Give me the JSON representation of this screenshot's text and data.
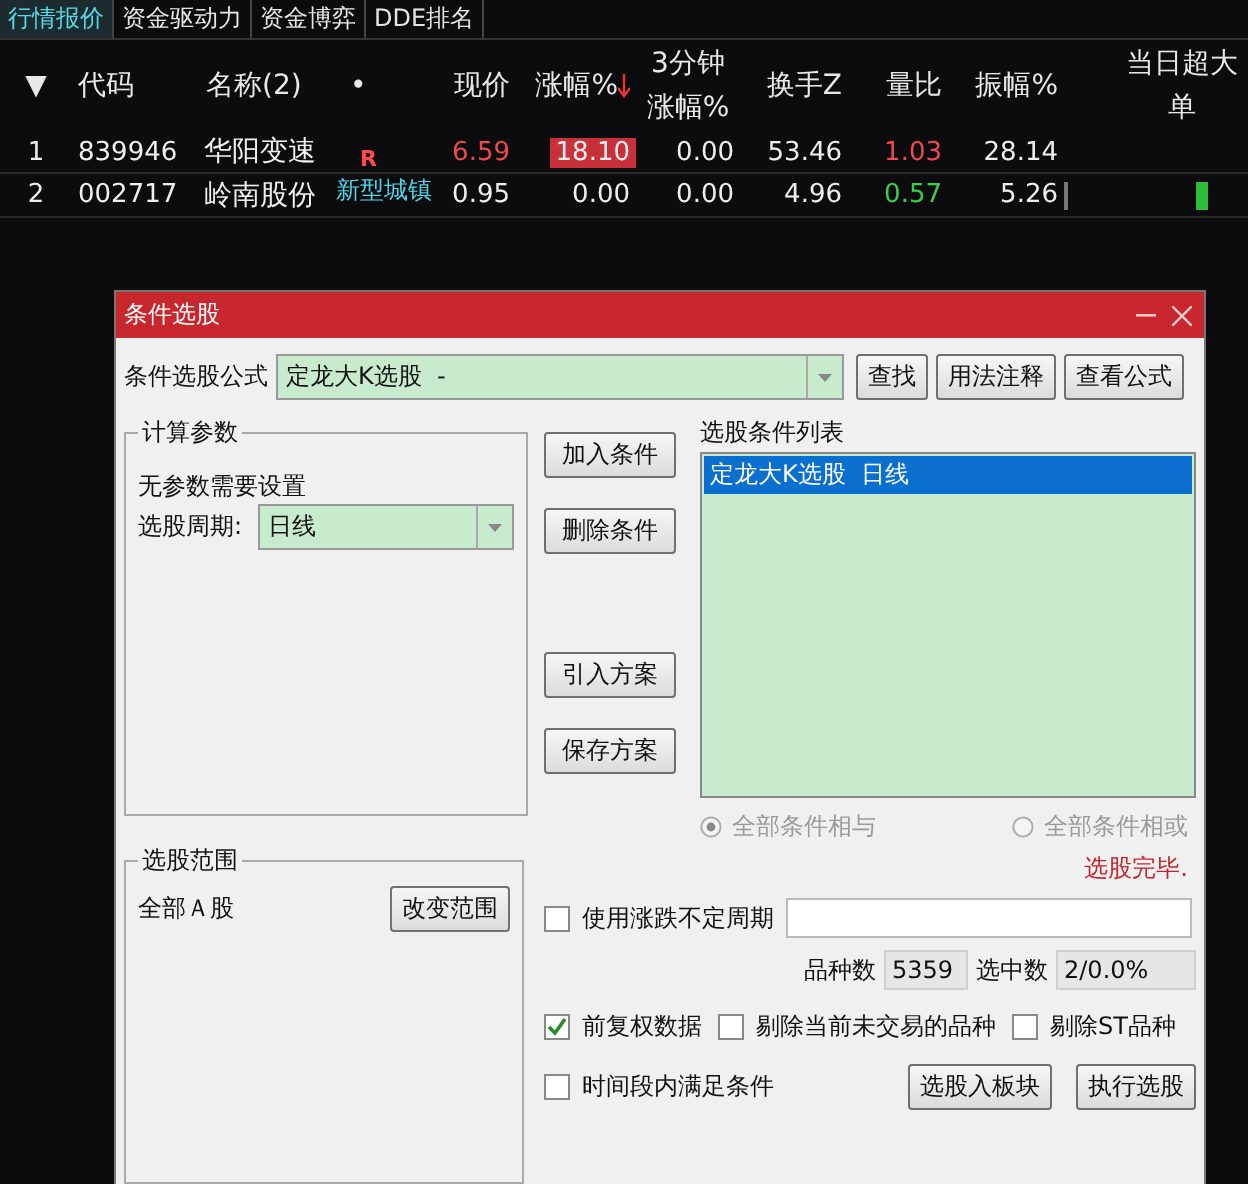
{
  "tabs": [
    {
      "label": "行情报价",
      "selected": true
    },
    {
      "label": "资金驱动力",
      "selected": false
    },
    {
      "label": "资金博弈",
      "selected": false
    },
    {
      "label": "DDE排名",
      "selected": false
    }
  ],
  "table": {
    "columns": [
      {
        "label": "▼"
      },
      {
        "label": "代码"
      },
      {
        "label": "名称(2)"
      },
      {
        "label": "•"
      },
      {
        "label": "现价"
      },
      {
        "label": "涨幅%",
        "sorted_descending": true
      },
      {
        "label": "3分钟涨幅%"
      },
      {
        "label": "换手Z"
      },
      {
        "label": "量比"
      },
      {
        "label": "振幅%"
      },
      {
        "label": "当日超大单"
      }
    ],
    "rows": [
      {
        "index": "1",
        "code": "839946",
        "name": "华阳变速",
        "tag": {
          "kind": "flag",
          "text": "R"
        },
        "price": {
          "text": "6.59",
          "color": "#f0484f"
        },
        "change": {
          "text": "18.10",
          "highlighted": true
        },
        "change3": "0.00",
        "turnover": "53.46",
        "ratio": {
          "text": "1.03",
          "color": "#f0484f"
        },
        "amplitude": "28.14",
        "bar": false
      },
      {
        "index": "2",
        "code": "002717",
        "name": "岭南股份",
        "tag": {
          "kind": "concept",
          "text": "新型城镇"
        },
        "price": {
          "text": "0.95",
          "color": "#eeeeee"
        },
        "change": {
          "text": "0.00",
          "highlighted": false
        },
        "change3": "0.00",
        "turnover": "4.96",
        "ratio": {
          "text": "0.57",
          "color": "#3ccc4a"
        },
        "amplitude": "5.26",
        "bar": true
      }
    ]
  },
  "dialog": {
    "title": "条件选股",
    "formula_label": "条件选股公式",
    "formula_value": "定龙大K选股  -",
    "formula_buttons": [
      "查找",
      "用法注释",
      "查看公式"
    ],
    "params": {
      "title": "计算参数",
      "text": "无参数需要设置",
      "period_label": "选股周期:",
      "period_value": "日线"
    },
    "middle_buttons": [
      "加入条件",
      "删除条件",
      "引入方案",
      "保存方案"
    ],
    "condition_list": {
      "label": "选股条件列表",
      "items": [
        {
          "text": "定龙大K选股  日线",
          "selected": true
        }
      ]
    },
    "logic": [
      {
        "label": "全部条件相与",
        "selected": true
      },
      {
        "label": "全部条件相或",
        "selected": false
      }
    ],
    "range": {
      "title": "选股范围",
      "text": "全部Ａ股",
      "button": "改变范围"
    },
    "status": "选股完毕.",
    "variable_period": {
      "label": "使用涨跌不定周期",
      "checked": false
    },
    "counts": [
      {
        "label": "品种数",
        "value": "5359"
      },
      {
        "label": "选中数",
        "value": "2/0.0%"
      }
    ],
    "options": [
      {
        "label": "前复权数据",
        "checked": true
      },
      {
        "label": "剔除当前未交易的品种",
        "checked": false
      },
      {
        "label": "剔除ST品种",
        "checked": false
      }
    ],
    "period_condition": {
      "label": "时间段内满足条件",
      "checked": false
    },
    "action_buttons": [
      "选股入板块",
      "执行选股"
    ]
  }
}
